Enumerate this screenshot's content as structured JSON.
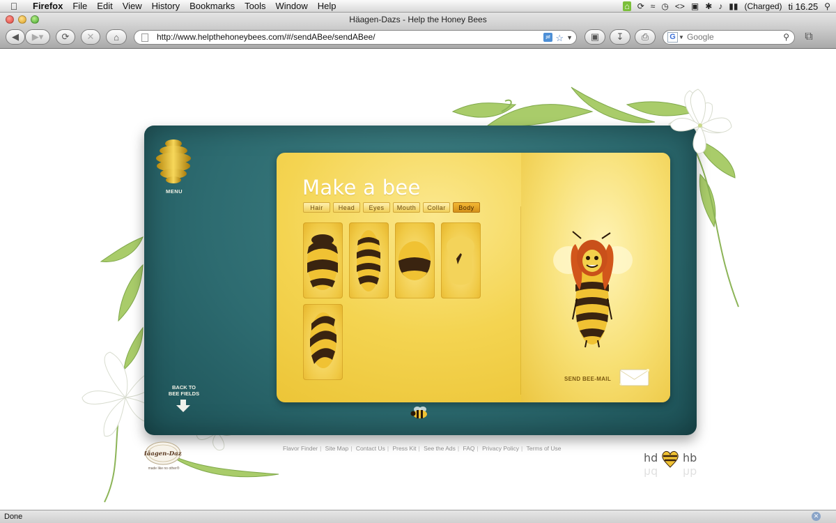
{
  "menubar": {
    "app": "Firefox",
    "items": [
      "File",
      "Edit",
      "View",
      "History",
      "Bookmarks",
      "Tools",
      "Window",
      "Help"
    ],
    "battery_status": "(Charged)",
    "clock": "ti 16.25"
  },
  "window": {
    "title": "Häagen-Dazs - Help the Honey Bees"
  },
  "toolbar": {
    "url": "http://www.helpthehoneybees.com/#/sendABee/sendABee/",
    "search_placeholder": "Google"
  },
  "site": {
    "menu_label": "MENU",
    "back_label_line1": "BACK TO",
    "back_label_line2": "BEE FIELDS",
    "title": "Make a bee",
    "tabs": [
      {
        "label": "Hair",
        "active": false
      },
      {
        "label": "Head",
        "active": false
      },
      {
        "label": "Eyes",
        "active": false
      },
      {
        "label": "Mouth",
        "active": false
      },
      {
        "label": "Collar",
        "active": false
      },
      {
        "label": "Body",
        "active": true
      }
    ],
    "body_options": [
      "striped-round",
      "striped-long",
      "half-striped-round",
      "pear-plain",
      "spiral-striped"
    ],
    "send_label": "SEND BEE-MAIL"
  },
  "footer": {
    "links": [
      "Flavor Finder",
      "Site Map",
      "Contact Us",
      "Press Kit",
      "See the Ads",
      "FAQ",
      "Privacy Policy",
      "Terms of Use"
    ],
    "brand_logo": "Häagen-Dazs",
    "brand_tagline": "made like no other®",
    "hdhb_left": "hd",
    "hdhb_right": "hb"
  },
  "statusbar": {
    "text": "Done"
  },
  "colors": {
    "stage_teal": "#2d6b70",
    "panel_yellow": "#f4d451",
    "tab_active": "#d3901b",
    "bee_brown": "#3a2410"
  }
}
